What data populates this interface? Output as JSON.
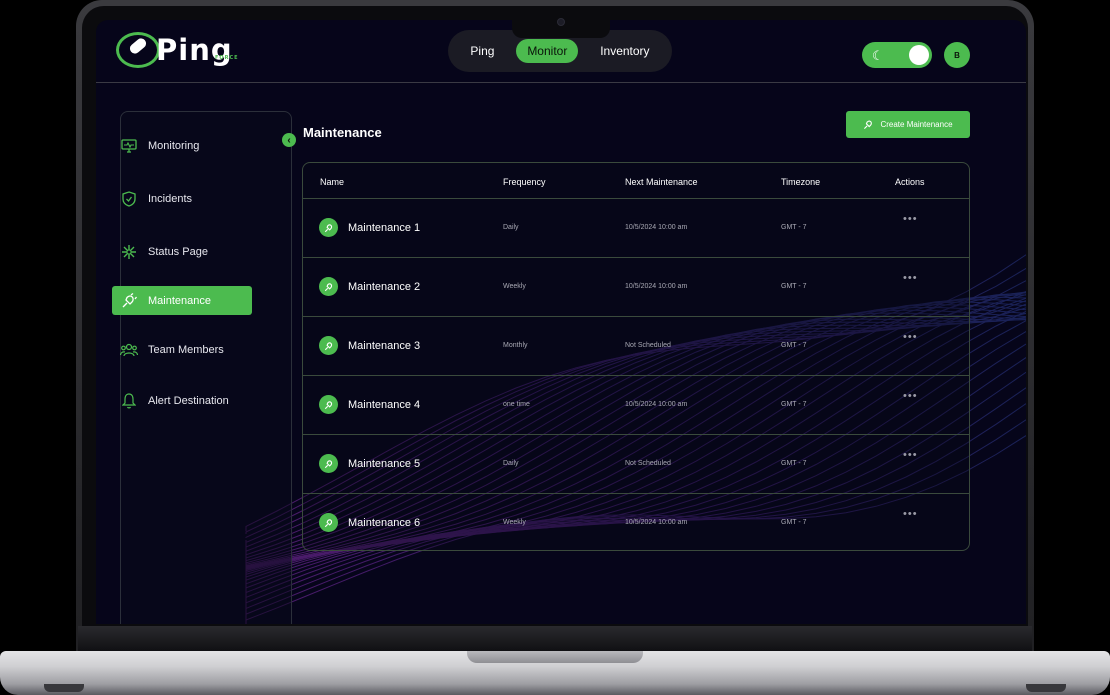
{
  "brand": {
    "name": "Ping",
    "sub": "FORCE"
  },
  "top_nav": [
    "Ping",
    "Monitor",
    "Inventory"
  ],
  "top_nav_active": "Monitor",
  "user": {
    "initial": "B"
  },
  "theme_toggle": {
    "icon": "moon-icon",
    "state": "on"
  },
  "sidebar": {
    "items": [
      {
        "label": "Monitoring",
        "icon": "monitor-icon"
      },
      {
        "label": "Incidents",
        "icon": "shield-icon"
      },
      {
        "label": "Status Page",
        "icon": "asterisk-icon"
      },
      {
        "label": "Maintenance",
        "icon": "plug-icon",
        "active": true
      },
      {
        "label": "Team Members",
        "icon": "team-icon"
      },
      {
        "label": "Alert Destination",
        "icon": "bell-icon"
      }
    ]
  },
  "page": {
    "title": "Maintenance",
    "create_button": "Create Maintenance"
  },
  "table": {
    "headers": [
      "Name",
      "Frequency",
      "Next Maintenance",
      "Timezone",
      "Actions"
    ],
    "rows": [
      {
        "name": "Maintenance 1",
        "frequency": "Daily",
        "next": "10/5/2024 10:00 am",
        "tz": "GMT - 7",
        "actions": "•••"
      },
      {
        "name": "Maintenance 2",
        "frequency": "Weekly",
        "next": "10/5/2024 10:00 am",
        "tz": "GMT - 7",
        "actions": "•••"
      },
      {
        "name": "Maintenance 3",
        "frequency": "Monthly",
        "next": "Not Scheduled",
        "tz": "GMT - 7",
        "actions": "•••"
      },
      {
        "name": "Maintenance 4",
        "frequency": "one time",
        "next": "10/5/2024 10:00 am",
        "tz": "GMT - 7",
        "actions": "•••"
      },
      {
        "name": "Maintenance 5",
        "frequency": "Daily",
        "next": "Not Scheduled",
        "tz": "GMT - 7",
        "actions": "•••"
      },
      {
        "name": "Maintenance 6",
        "frequency": "Weekly",
        "next": "10/5/2024 10:00 am",
        "tz": "GMT - 7",
        "actions": "•••"
      }
    ]
  },
  "colors": {
    "accent": "#4cbb4f",
    "background": "#06051a",
    "wave": "#6b2aa8"
  }
}
